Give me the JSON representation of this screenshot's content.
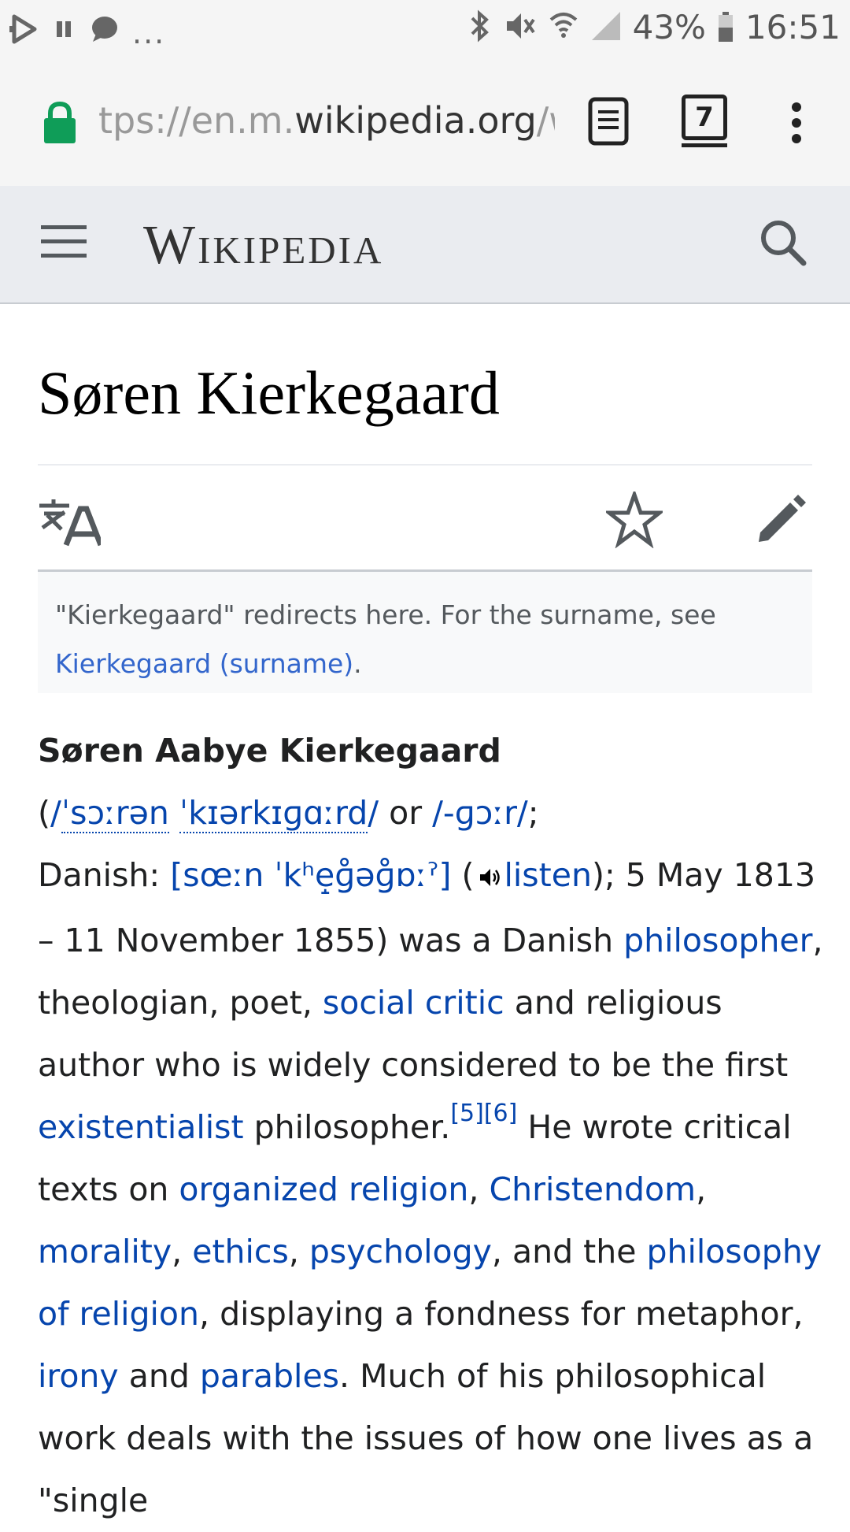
{
  "status_bar": {
    "left_dots": "...",
    "battery": "43%",
    "time": "16:51"
  },
  "browser": {
    "url_prefix": "tps://en.m.",
    "url_domain": "wikipedia.org",
    "url_suffix": "/wi",
    "tab_count": "7"
  },
  "wiki_header": {
    "wordmark": "Wikipedia"
  },
  "article": {
    "title": "Søren Kierkegaard",
    "hatnote": {
      "text_before": "\"Kierkegaard\" redirects here. For the surname, see ",
      "link": "Kierkegaard (surname)",
      "text_after": "."
    },
    "intro": {
      "name": "Søren Aabye Kierkegaard",
      "t_open": "(",
      "ipa1_slash": "/",
      "ipa1_a": "ˈsɔːrən",
      "ipa1_b": "ˈkɪərkɪɡɑːrd",
      "ipa1_close": "/",
      "t_or": " or ",
      "ipa2": "/-ɡɔːr/",
      "t_semi": ";",
      "t_danish": "Danish: ",
      "ipa3": "[sœːn ˈkʰe̝ɡ̊əɡ̊ɒːˀ]",
      "t_paren": " (",
      "listen": "listen",
      "t_dates": "); 5 May 1813 – 11 November 1855) was a Danish ",
      "link_philosopher": "philosopher",
      "t_theo": ", theologian, poet, ",
      "link_social_critic": "social critic",
      "t_religious": " and religious author who is widely considered to be the first ",
      "link_existentialist": "existentialist",
      "t_philosopher": " philosopher.",
      "ref5": "[5]",
      "ref6": "[6]",
      "t_he_wrote": " He wrote critical texts on ",
      "link_organized_religion": "organized religion",
      "t_comma1": ", ",
      "link_christendom": "Christendom",
      "t_comma2": ", ",
      "link_morality": "morality",
      "t_comma3": ", ",
      "link_ethics": "ethics",
      "t_comma4": ", ",
      "link_psychology": "psychology",
      "t_and_the": ", and the ",
      "link_philosophy_of_religion": "philosophy of religion",
      "t_displaying": ", displaying a fondness for metaphor, ",
      "link_irony": "irony",
      "t_and": " and ",
      "link_parables": "parables",
      "t_much": ". Much of his philosophical work deals with the issues of how one lives as a \"single"
    }
  },
  "colors": {
    "link": "#0645ad",
    "hatnote_link": "#3366cc",
    "lock_green": "#0f9d58",
    "header_bg": "#eaecf0"
  }
}
